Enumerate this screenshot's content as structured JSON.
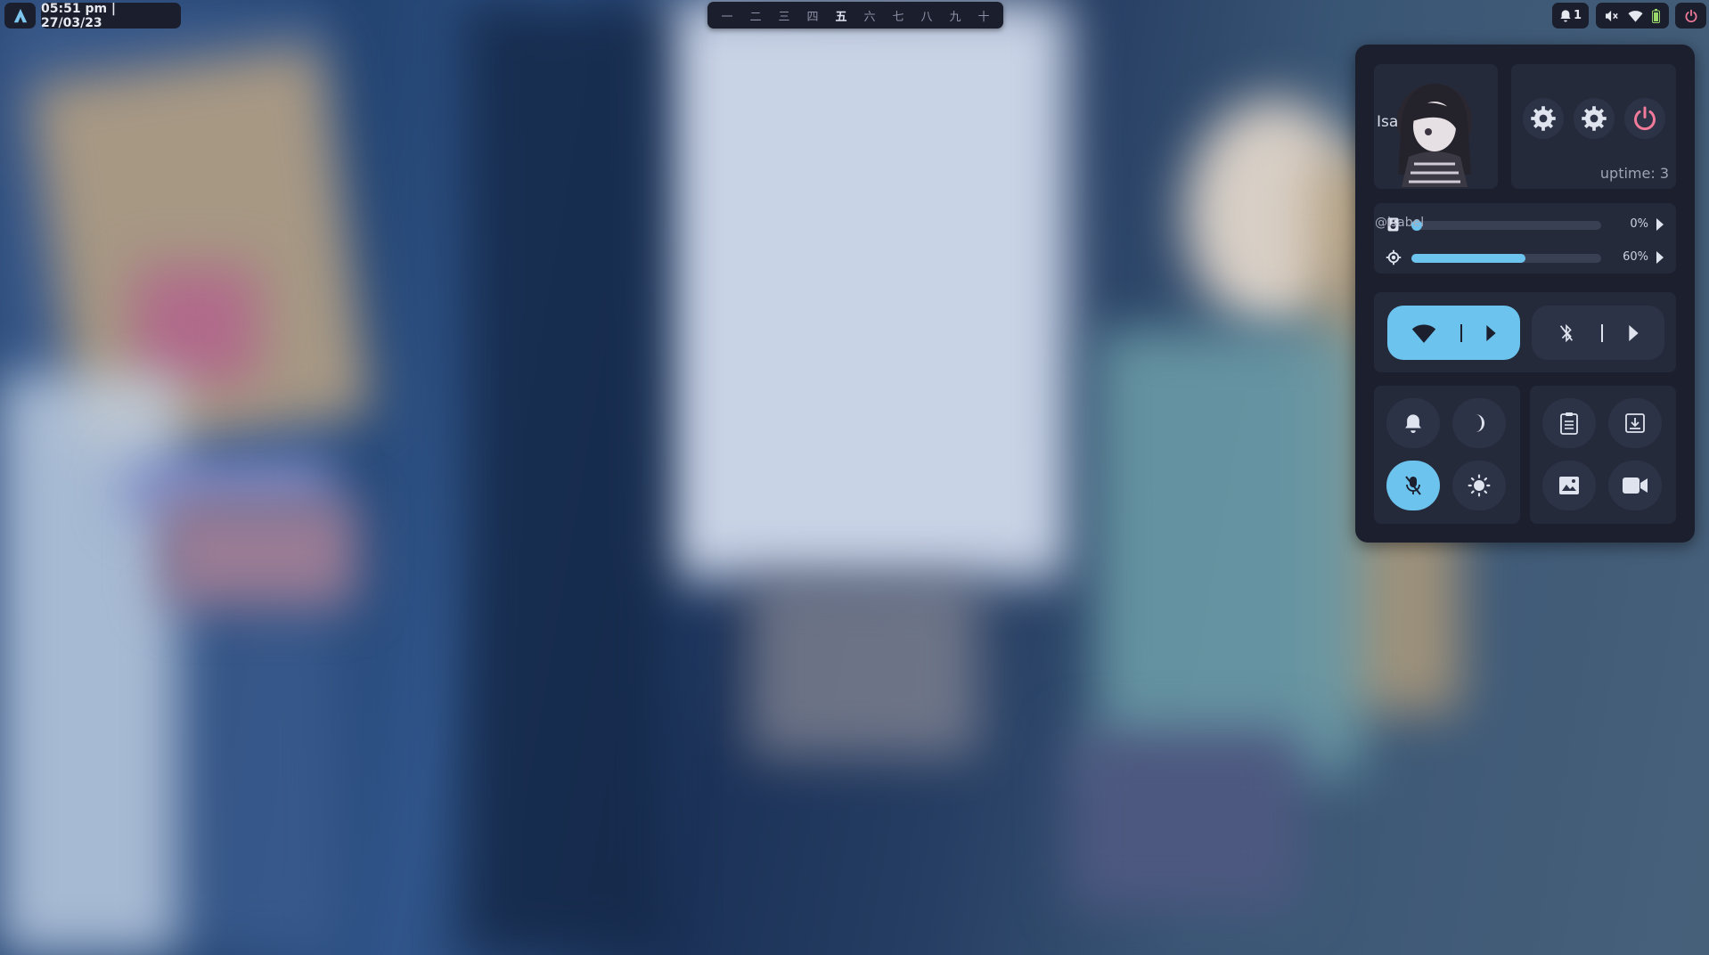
{
  "topbar": {
    "clock_text": "05:51 pm  |  27/03/23",
    "workspaces": [
      "一",
      "二",
      "三",
      "四",
      "五",
      "六",
      "七",
      "八",
      "九",
      "十"
    ],
    "active_workspace_index": 4,
    "notification_count": "1"
  },
  "panel": {
    "user_name": "Isabel",
    "user_handle": "@isabel",
    "uptime_text": "uptime: 3",
    "volume": {
      "percent_text": "0%",
      "value": 0
    },
    "brightness": {
      "percent_text": "60%",
      "value": 60
    },
    "wifi_enabled": true,
    "bluetooth_enabled": false,
    "quick_toggles": [
      {
        "name": "notifications-toggle",
        "icon": "bell-icon",
        "on": false
      },
      {
        "name": "night-mode-toggle",
        "icon": "moon-icon",
        "on": false
      },
      {
        "name": "mic-mute-toggle",
        "icon": "mic-off-icon",
        "on": true
      },
      {
        "name": "theme-toggle",
        "icon": "sun-icon",
        "on": false
      }
    ],
    "utilities": [
      {
        "name": "clipboard-button",
        "icon": "clipboard-icon"
      },
      {
        "name": "download-button",
        "icon": "download-icon"
      },
      {
        "name": "screenshot-button",
        "icon": "image-icon"
      },
      {
        "name": "screen-record-button",
        "icon": "video-icon"
      }
    ]
  },
  "colors": {
    "accent": "#6cc4ee",
    "panel_bg": "#1c1f2e",
    "card_bg": "#252a3b",
    "power_red": "#f07a9a",
    "battery_green": "#9ad86a"
  }
}
